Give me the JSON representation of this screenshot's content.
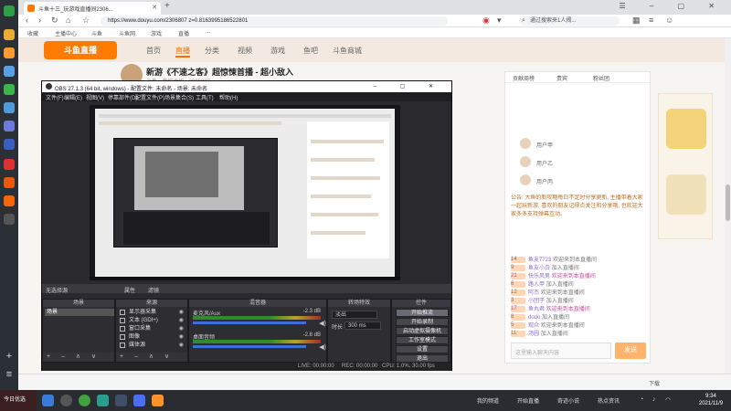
{
  "browser": {
    "tab_title": "斗鱼十三_玩游戏直播间2306...",
    "tab_close": "✕",
    "new_tab": "+",
    "window_controls": "☰ – ▢ ✕",
    "url": "https://www.douyu.com/2306807  z=0.8163995186522801",
    "search_placeholder": "通过搜索来1人揭...",
    "bookmarks": [
      "收藏",
      "主播中心",
      "斗鱼",
      "斗鱼网",
      "游戏",
      "直播",
      "..."
    ]
  },
  "douyu": {
    "logo": "斗鱼直播",
    "nav": [
      {
        "label": "首页",
        "active": false
      },
      {
        "label": "直播",
        "active": true
      },
      {
        "label": "分类",
        "active": false
      },
      {
        "label": "视频",
        "active": false
      },
      {
        "label": "游戏",
        "active": false
      },
      {
        "label": "鱼吧",
        "active": false
      },
      {
        "label": "斗鱼商城",
        "active": false
      }
    ],
    "stream_title": "新游《不速之客》超惊悚首播 - 超小敌入",
    "streamer_meta": "斗鱼 · 单机主机 · 2306807",
    "chat_tabs": [
      "贡献周榜",
      "贵宾",
      "粉丝团"
    ],
    "ranks": [
      "用户甲",
      "用户乙",
      "用户丙"
    ],
    "notice": "公告: 大鱼的新攻略每日不定时分享更新, 主播带着大家一起玩新游, 喜欢的朋友记得点关注和分享哦, 也欢迎大家多多支持弹幕互动。",
    "messages": [
      {
        "level": "14",
        "user": "鱼友7723",
        "text": "欢迎来到本直播间",
        "sys": false
      },
      {
        "level": "9",
        "user": "鱼友小白",
        "text": "加入直播间",
        "sys": false
      },
      {
        "level": "21",
        "user": "快乐风男",
        "text": "欢迎来到本直播间",
        "sys": true
      },
      {
        "level": "6",
        "user": "路人甲",
        "text": "加入直播间",
        "sys": false
      },
      {
        "level": "12",
        "user": "阿杰",
        "text": "欢迎来到本直播间",
        "sys": false
      },
      {
        "level": "3",
        "user": "小团子",
        "text": "加入直播间",
        "sys": false
      },
      {
        "level": "17",
        "user": "鱼丸君",
        "text": "欢迎来到本直播间",
        "sys": true
      },
      {
        "level": "8",
        "user": "dodo",
        "text": "加入直播间",
        "sys": false
      },
      {
        "level": "5",
        "user": "观众",
        "text": "欢迎来到本直播间",
        "sys": false
      },
      {
        "level": "11",
        "user": "汤圆",
        "text": "加入直播间",
        "sys": false
      }
    ],
    "chat_placeholder": "这里输入聊天内容",
    "send_label": "发送"
  },
  "obs": {
    "title": "OBS 27.1.3 (64 bit, windows) - 配置文件: 未命名 - 场景: 未命名",
    "window_controls": "– ▢ ✕",
    "menu": [
      "文件(F)",
      "编辑(E)",
      "视图(V)",
      "停靠部件(D)",
      "配置文件(P)",
      "场景集合(S)",
      "工具(T)",
      "帮助(H)"
    ],
    "dockbar_left": "无选择源",
    "dockbar_properties": "属性",
    "dockbar_filters": "滤镜",
    "docks": {
      "scenes": "场景",
      "sources": "来源",
      "mixer": "混音器",
      "transitions": "转场特效",
      "controls": "控件"
    },
    "scene_item": "场景",
    "sources": [
      "显示器采集",
      "文本 (GDI+)",
      "窗口采集",
      "图像",
      "媒体源"
    ],
    "mixer": [
      {
        "name": "麦克风/Aux",
        "db": "-2.3 dB"
      },
      {
        "name": "桌面音频",
        "db": "-2.8 dB"
      }
    ],
    "transition_type": "淡出",
    "duration_label": "时长",
    "duration_value": "300 ms",
    "controls": [
      "开始推流",
      "开始录制",
      "启动虚拟摄像机",
      "工作室模式",
      "设置",
      "退出"
    ],
    "dock_footer": "+ – ∧ ∨",
    "status": {
      "live": "LIVE: 00:00:00",
      "rec": "REC: 00:00:00",
      "cpu": "CPU: 1.0%, 30.00 fps"
    }
  },
  "taskbar": {
    "news": "今日优选",
    "items": [
      "我的频道",
      "开始直播",
      "奇迹小说",
      "热点资讯"
    ],
    "tray_label": "下载",
    "time": "9:34",
    "date": "2021/11/9"
  },
  "colors": {
    "douyu_orange": "#ff7b00",
    "obs_bg": "#2a2a2e",
    "taskbar": "#2a2c31"
  }
}
